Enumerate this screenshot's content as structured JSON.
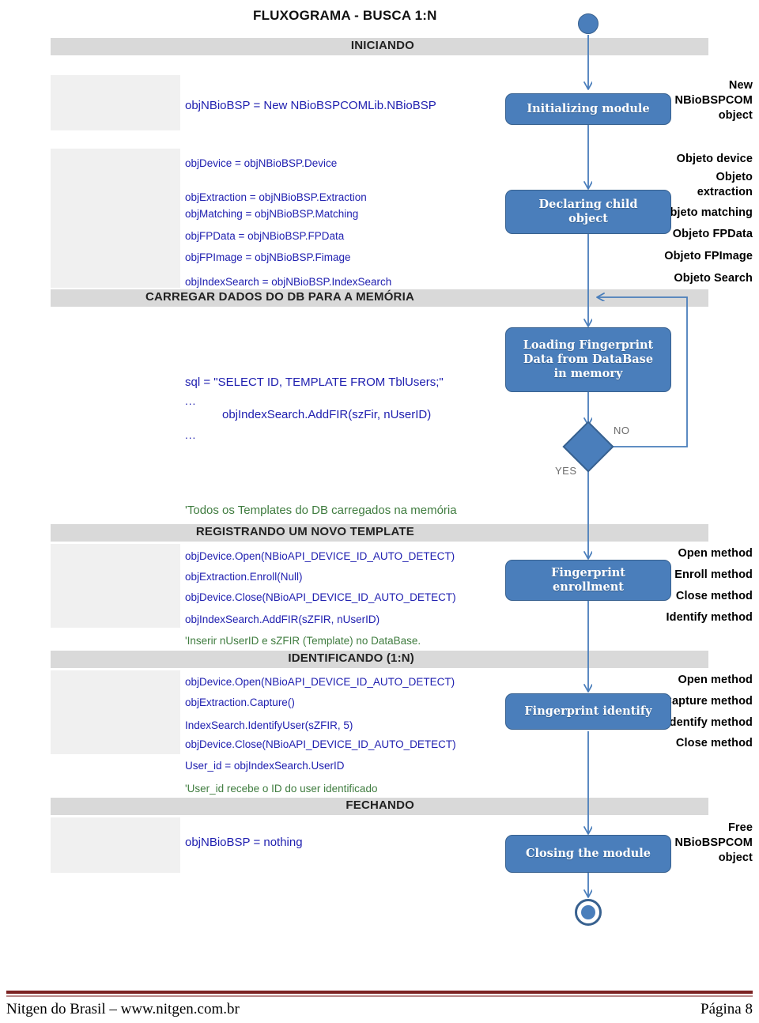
{
  "document": {
    "title": "FLUXOGRAMA - BUSCA 1:N"
  },
  "sections": [
    {
      "key": "iniciando",
      "label": "INICIANDO"
    },
    {
      "key": "carregar",
      "label": "CARREGAR DADOS DO DB PARA A MEMÓRIA"
    },
    {
      "key": "registrando",
      "label": "REGISTRANDO UM NOVO TEMPLATE"
    },
    {
      "key": "identificando",
      "label": "IDENTIFICANDO (1:N)"
    },
    {
      "key": "fechando",
      "label": "FECHANDO"
    }
  ],
  "labels": {
    "new_object": "New\nNBioBSPCOM\nobject",
    "new_object_l1": "New",
    "new_object_l2": "NBioBSPCOM",
    "new_object_l3": "object",
    "objeto_device": "Objeto device",
    "objeto_extraction_l1": "Objeto",
    "objeto_extraction_l2": "extraction",
    "objeto_matching": "Objeto matching",
    "objeto_fpdata": "Objeto FPData",
    "objeto_fpimage": "Objeto FPImage",
    "objeto_search": "Objeto Search",
    "open_method": "Open method",
    "enroll_method": "Enroll method",
    "close_method": "Close method",
    "identify_method": "Identify method",
    "capture_method": "Capture method",
    "free_object_l1": "Free",
    "free_object_l2": "NBioBSPCOM",
    "free_object_l3": "object"
  },
  "code": {
    "new_nbiobsp": "objNBioBSP = New NBioBSPCOMLib.NBioBSP",
    "device": "objDevice = objNBioBSP.Device",
    "extraction": "objExtraction = objNBioBSP.Extraction",
    "matching": "objMatching = objNBioBSP.Matching",
    "fpdata": "objFPData = objNBioBSP.FPData",
    "fpimage": "objFPImage = objNBioBSP.Fimage",
    "indexsearch": "objIndexSearch = objNBioBSP.IndexSearch",
    "sql": "sql = \"SELECT ID, TEMPLATE FROM TblUsers;\"",
    "dots1": "...",
    "addfir_loop": "objIndexSearch.AddFIR(szFir, nUserID)",
    "dots2": "...",
    "note_templates": "'Todos os Templates do DB carregados na memória",
    "enr_open": "objDevice.Open(NBioAPI_DEVICE_ID_AUTO_DETECT)",
    "enr_enroll": "objExtraction.Enroll(Null)",
    "enr_close": "objDevice.Close(NBioAPI_DEVICE_ID_AUTO_DETECT)",
    "enr_addfir": "objIndexSearch.AddFIR(sZFIR, nUserID)",
    "note_inserir": "'Inserir nUserID e sZFIR (Template) no DataBase.",
    "idn_open": "objDevice.Open(NBioAPI_DEVICE_ID_AUTO_DETECT)",
    "idn_capture": "objExtraction.Capture()",
    "idn_identify": "IndexSearch.IdentifyUser(sZFIR, 5)",
    "idn_close": "objDevice.Close(NBioAPI_DEVICE_ID_AUTO_DETECT)",
    "idn_userid": "User_id = objIndexSearch.UserID",
    "note_userid": "'User_id recebe o ID do user identificado",
    "free_nothing": "objNBioBSP = nothing"
  },
  "flowchart": {
    "start_node": "start-circle",
    "end_node": "end-circle",
    "nodes": [
      {
        "id": "initializing",
        "label": "Initializing module"
      },
      {
        "id": "declaring",
        "label": "Declaring child\nobject",
        "line1": "Declaring child",
        "line2": "object"
      },
      {
        "id": "loading",
        "label": "Loading Fingerprint Data from  DataBase in memory",
        "line1": "Loading Fingerprint",
        "line2": "Data from  DataBase",
        "line3": "in memory"
      },
      {
        "id": "enrollment",
        "label": "Fingerprint enrollment",
        "line1": "Fingerprint",
        "line2": "enrollment"
      },
      {
        "id": "identify",
        "label": "Fingerprint identify"
      },
      {
        "id": "closing",
        "label": "Closing the module"
      }
    ],
    "decision": {
      "id": "eof-decision",
      "yes": "YES",
      "no": "NO"
    }
  },
  "colors": {
    "node_fill": "#4a7ebb",
    "node_stroke": "#38618f",
    "band": "#d9d9d9",
    "label_block": "#f0f0f0",
    "code": "#2020b0",
    "comment": "#3f7c3f",
    "footer_rule": "#7b2222"
  },
  "footer": {
    "left": "Nitgen do Brasil – www.nitgen.com.br",
    "right": "Página 8"
  }
}
